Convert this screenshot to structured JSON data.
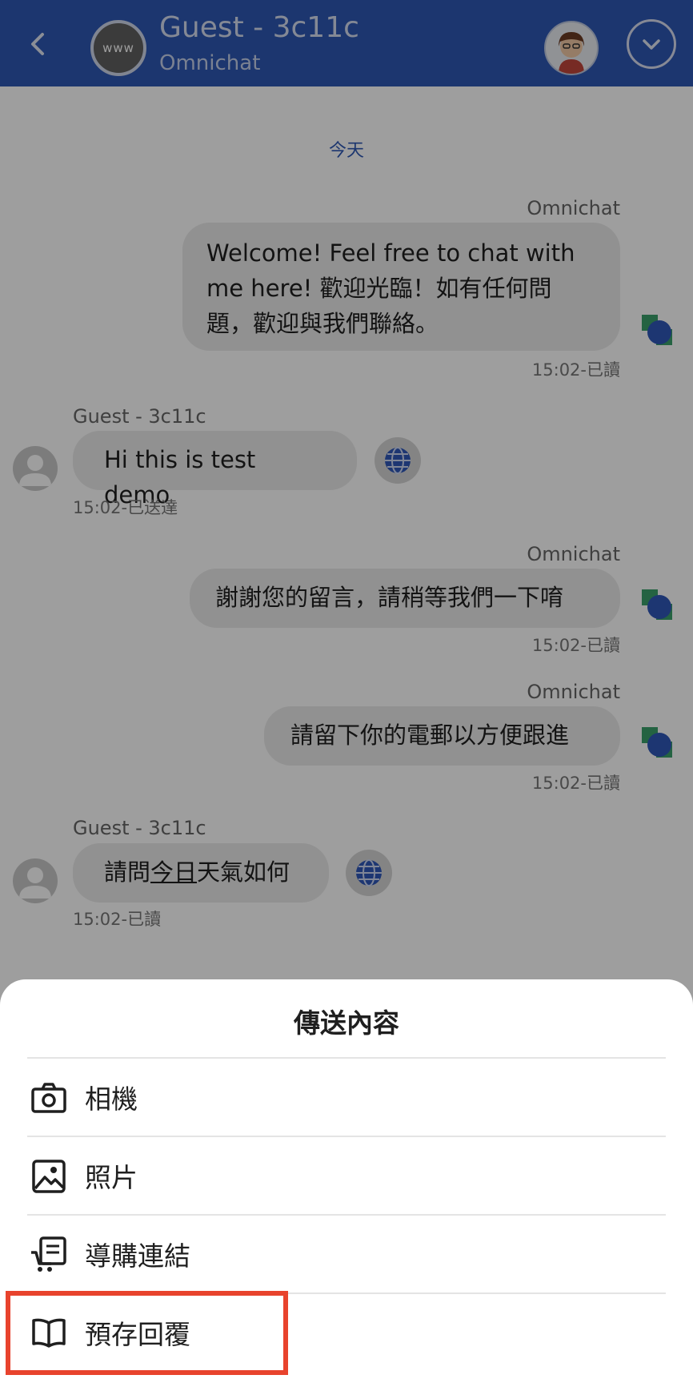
{
  "header": {
    "site_avatar_text": "www",
    "title": "Guest - 3c11c",
    "subtitle": "Omnichat"
  },
  "chat": {
    "day_label": "今天",
    "messages": [
      {
        "sender": "Omnichat",
        "text_lines": [
          "Welcome! Feel free to chat with",
          "me here! 歡迎光臨！如有任何問",
          "題，歡迎與我們聯絡。"
        ],
        "meta": "15:02-已讀"
      },
      {
        "sender": "Guest - 3c11c",
        "text": "Hi this is test demo",
        "meta": "15:02-已送達"
      },
      {
        "sender": "Omnichat",
        "text": "謝謝您的留言，請稍等我們一下唷",
        "meta": "15:02-已讀"
      },
      {
        "sender": "Omnichat",
        "text": "請留下你的電郵以方便跟進",
        "meta": "15:02-已讀"
      },
      {
        "sender": "Guest - 3c11c",
        "text_pre": "請問",
        "text_underlined": "今日",
        "text_post": "天氣如何",
        "meta": "15:02-已讀"
      }
    ]
  },
  "sheet": {
    "title": "傳送內容",
    "items": [
      {
        "label": "相機",
        "icon": "camera-icon"
      },
      {
        "label": "照片",
        "icon": "photo-icon"
      },
      {
        "label": "導購連結",
        "icon": "cart-link-icon"
      },
      {
        "label": "預存回覆",
        "icon": "book-icon"
      }
    ]
  },
  "colors": {
    "header": "#2e57b4",
    "highlight": "#e8432d"
  }
}
